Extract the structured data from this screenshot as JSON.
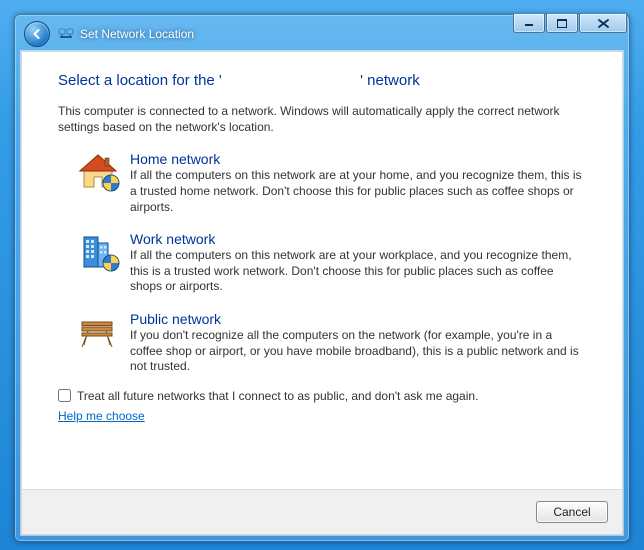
{
  "window": {
    "title": "Set Network Location"
  },
  "heading_prefix": "Select a location for the '",
  "heading_suffix": "' network",
  "intro": "This computer is connected to a network. Windows will automatically apply the correct network settings based on the network's location.",
  "options": {
    "home": {
      "title": "Home network",
      "desc": "If all the computers on this network are at your home, and you recognize them, this is a trusted home network.  Don't choose this for public places such as coffee shops or airports."
    },
    "work": {
      "title": "Work network",
      "desc": "If all the computers on this network are at your workplace, and you recognize them, this is a trusted work network.  Don't choose this for public places such as coffee shops or airports."
    },
    "public": {
      "title": "Public network",
      "desc": "If you don't recognize all the computers on the network (for example, you're in a coffee shop or airport, or you have mobile broadband), this is a public network and is not trusted."
    }
  },
  "checkbox_label": "Treat all future networks that I connect to as public, and don't ask me again.",
  "help_link": "Help me choose",
  "buttons": {
    "cancel": "Cancel"
  }
}
